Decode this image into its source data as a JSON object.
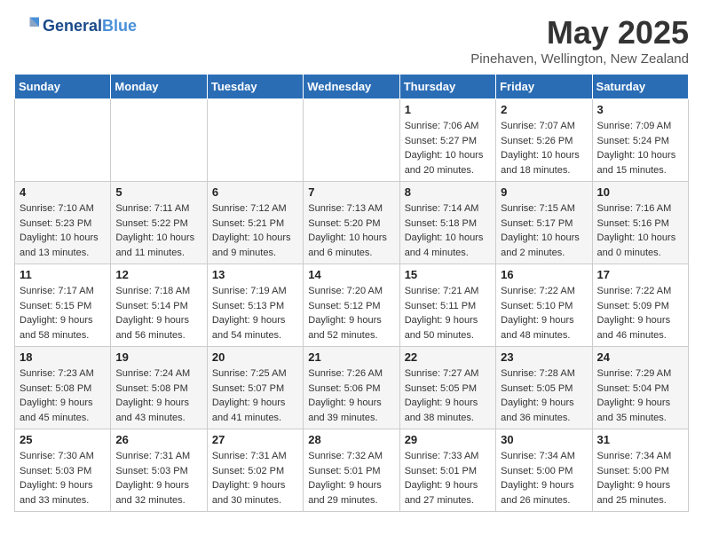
{
  "header": {
    "logo_line1": "General",
    "logo_line2": "Blue",
    "title": "May 2025",
    "location": "Pinehaven, Wellington, New Zealand"
  },
  "weekdays": [
    "Sunday",
    "Monday",
    "Tuesday",
    "Wednesday",
    "Thursday",
    "Friday",
    "Saturday"
  ],
  "weeks": [
    [
      {
        "day": "",
        "info": ""
      },
      {
        "day": "",
        "info": ""
      },
      {
        "day": "",
        "info": ""
      },
      {
        "day": "",
        "info": ""
      },
      {
        "day": "1",
        "info": "Sunrise: 7:06 AM\nSunset: 5:27 PM\nDaylight: 10 hours\nand 20 minutes."
      },
      {
        "day": "2",
        "info": "Sunrise: 7:07 AM\nSunset: 5:26 PM\nDaylight: 10 hours\nand 18 minutes."
      },
      {
        "day": "3",
        "info": "Sunrise: 7:09 AM\nSunset: 5:24 PM\nDaylight: 10 hours\nand 15 minutes."
      }
    ],
    [
      {
        "day": "4",
        "info": "Sunrise: 7:10 AM\nSunset: 5:23 PM\nDaylight: 10 hours\nand 13 minutes."
      },
      {
        "day": "5",
        "info": "Sunrise: 7:11 AM\nSunset: 5:22 PM\nDaylight: 10 hours\nand 11 minutes."
      },
      {
        "day": "6",
        "info": "Sunrise: 7:12 AM\nSunset: 5:21 PM\nDaylight: 10 hours\nand 9 minutes."
      },
      {
        "day": "7",
        "info": "Sunrise: 7:13 AM\nSunset: 5:20 PM\nDaylight: 10 hours\nand 6 minutes."
      },
      {
        "day": "8",
        "info": "Sunrise: 7:14 AM\nSunset: 5:18 PM\nDaylight: 10 hours\nand 4 minutes."
      },
      {
        "day": "9",
        "info": "Sunrise: 7:15 AM\nSunset: 5:17 PM\nDaylight: 10 hours\nand 2 minutes."
      },
      {
        "day": "10",
        "info": "Sunrise: 7:16 AM\nSunset: 5:16 PM\nDaylight: 10 hours\nand 0 minutes."
      }
    ],
    [
      {
        "day": "11",
        "info": "Sunrise: 7:17 AM\nSunset: 5:15 PM\nDaylight: 9 hours\nand 58 minutes."
      },
      {
        "day": "12",
        "info": "Sunrise: 7:18 AM\nSunset: 5:14 PM\nDaylight: 9 hours\nand 56 minutes."
      },
      {
        "day": "13",
        "info": "Sunrise: 7:19 AM\nSunset: 5:13 PM\nDaylight: 9 hours\nand 54 minutes."
      },
      {
        "day": "14",
        "info": "Sunrise: 7:20 AM\nSunset: 5:12 PM\nDaylight: 9 hours\nand 52 minutes."
      },
      {
        "day": "15",
        "info": "Sunrise: 7:21 AM\nSunset: 5:11 PM\nDaylight: 9 hours\nand 50 minutes."
      },
      {
        "day": "16",
        "info": "Sunrise: 7:22 AM\nSunset: 5:10 PM\nDaylight: 9 hours\nand 48 minutes."
      },
      {
        "day": "17",
        "info": "Sunrise: 7:22 AM\nSunset: 5:09 PM\nDaylight: 9 hours\nand 46 minutes."
      }
    ],
    [
      {
        "day": "18",
        "info": "Sunrise: 7:23 AM\nSunset: 5:08 PM\nDaylight: 9 hours\nand 45 minutes."
      },
      {
        "day": "19",
        "info": "Sunrise: 7:24 AM\nSunset: 5:08 PM\nDaylight: 9 hours\nand 43 minutes."
      },
      {
        "day": "20",
        "info": "Sunrise: 7:25 AM\nSunset: 5:07 PM\nDaylight: 9 hours\nand 41 minutes."
      },
      {
        "day": "21",
        "info": "Sunrise: 7:26 AM\nSunset: 5:06 PM\nDaylight: 9 hours\nand 39 minutes."
      },
      {
        "day": "22",
        "info": "Sunrise: 7:27 AM\nSunset: 5:05 PM\nDaylight: 9 hours\nand 38 minutes."
      },
      {
        "day": "23",
        "info": "Sunrise: 7:28 AM\nSunset: 5:05 PM\nDaylight: 9 hours\nand 36 minutes."
      },
      {
        "day": "24",
        "info": "Sunrise: 7:29 AM\nSunset: 5:04 PM\nDaylight: 9 hours\nand 35 minutes."
      }
    ],
    [
      {
        "day": "25",
        "info": "Sunrise: 7:30 AM\nSunset: 5:03 PM\nDaylight: 9 hours\nand 33 minutes."
      },
      {
        "day": "26",
        "info": "Sunrise: 7:31 AM\nSunset: 5:03 PM\nDaylight: 9 hours\nand 32 minutes."
      },
      {
        "day": "27",
        "info": "Sunrise: 7:31 AM\nSunset: 5:02 PM\nDaylight: 9 hours\nand 30 minutes."
      },
      {
        "day": "28",
        "info": "Sunrise: 7:32 AM\nSunset: 5:01 PM\nDaylight: 9 hours\nand 29 minutes."
      },
      {
        "day": "29",
        "info": "Sunrise: 7:33 AM\nSunset: 5:01 PM\nDaylight: 9 hours\nand 27 minutes."
      },
      {
        "day": "30",
        "info": "Sunrise: 7:34 AM\nSunset: 5:00 PM\nDaylight: 9 hours\nand 26 minutes."
      },
      {
        "day": "31",
        "info": "Sunrise: 7:34 AM\nSunset: 5:00 PM\nDaylight: 9 hours\nand 25 minutes."
      }
    ]
  ]
}
